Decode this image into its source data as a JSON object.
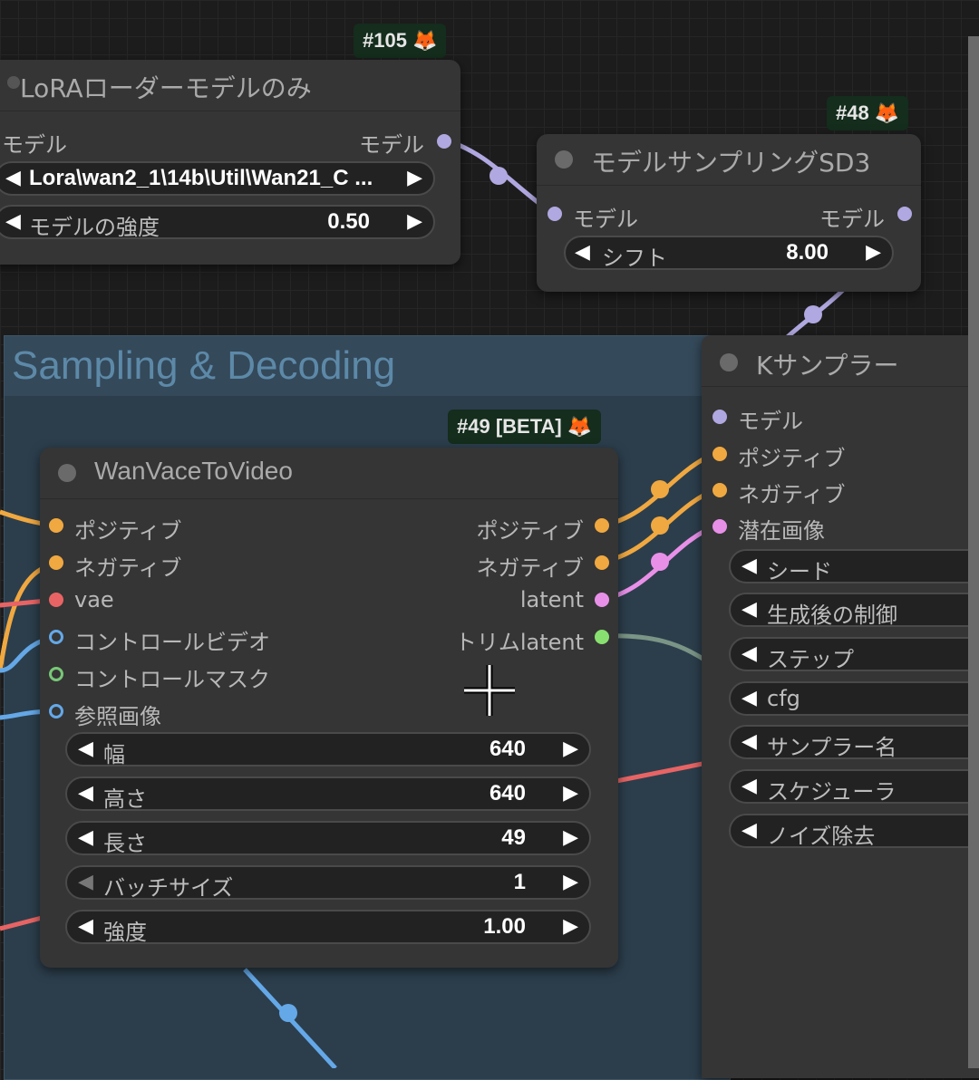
{
  "lora_node": {
    "badge": "#105",
    "title": "LoRAローダーモデルのみ",
    "input_model": "モデル",
    "output_model": "モデル",
    "widgets": [
      {
        "label": "Lora\\wan2_1\\14b\\Util\\Wan21_C ...",
        "value": ""
      },
      {
        "label": "モデルの強度",
        "value": "0.50"
      }
    ]
  },
  "sd3_node": {
    "badge": "#48",
    "title": "モデルサンプリングSD3",
    "input_model": "モデル",
    "output_model": "モデル",
    "widgets": [
      {
        "label": "シフト",
        "value": "8.00"
      }
    ]
  },
  "group": {
    "title": "Sampling & Decoding"
  },
  "wan_node": {
    "badge": "#49 [BETA]",
    "title": "WanVaceToVideo",
    "inputs": [
      "ポジティブ",
      "ネガティブ",
      "vae",
      "コントロールビデオ",
      "コントロールマスク",
      "参照画像"
    ],
    "outputs": [
      "ポジティブ",
      "ネガティブ",
      "latent",
      "トリムlatent"
    ],
    "widgets": [
      {
        "label": "幅",
        "value": "640"
      },
      {
        "label": "高さ",
        "value": "640"
      },
      {
        "label": "長さ",
        "value": "49"
      },
      {
        "label": "バッチサイズ",
        "value": "1"
      },
      {
        "label": "強度",
        "value": "1.00"
      }
    ]
  },
  "ksampler_node": {
    "title": "Kサンプラー",
    "inputs": [
      "モデル",
      "ポジティブ",
      "ネガティブ",
      "潜在画像"
    ],
    "widgets": [
      "シード",
      "生成後の制御",
      "ステップ",
      "cfg",
      "サンプラー名",
      "スケジューラ",
      "ノイズ除去"
    ]
  },
  "colors": {
    "model": "#b0a8e0",
    "conditioning": "#f0a840",
    "vae": "#e86464",
    "image": "#64a8e8",
    "mask": "#78c878",
    "latent": "#e890e8",
    "trim": "#88e070"
  },
  "icons": {
    "badge_icon": "fox-icon",
    "arrow_left": "arrow-left-icon",
    "arrow_right": "arrow-right-icon",
    "cursor": "crosshair-cursor-icon"
  }
}
